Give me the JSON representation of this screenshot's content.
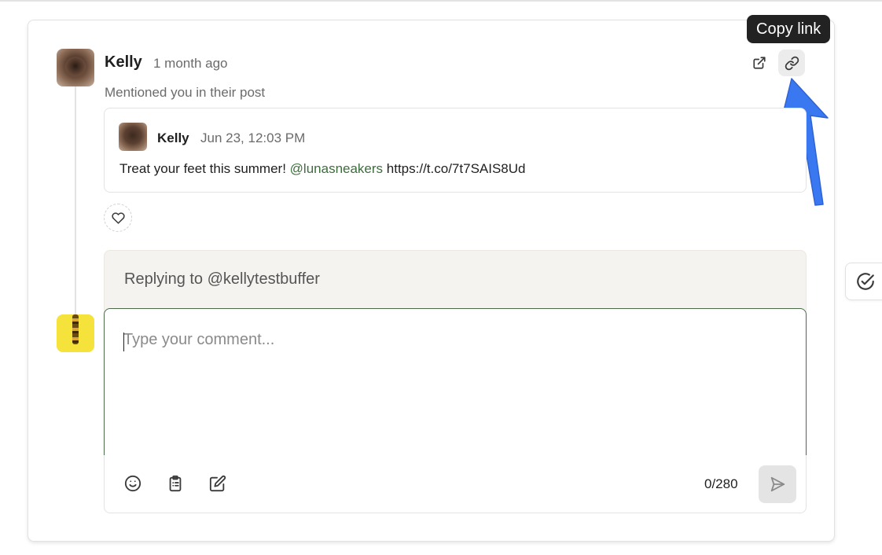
{
  "notification": {
    "author": "Kelly",
    "time": "1 month ago",
    "subtitle": "Mentioned you in their post",
    "tooltip": "Copy link"
  },
  "post": {
    "author": "Kelly",
    "date": "Jun 23, 12:03 PM",
    "text_before": "Treat your feet this summer! ",
    "mention": "@lunasneakers",
    "text_after": " https://t.co/7t7SAIS8Ud"
  },
  "reply": {
    "replying_to": "Replying to @kellytestbuffer",
    "placeholder": "Type your comment...",
    "value": "",
    "counter": "0/280"
  },
  "icons": {
    "open": "external-link-icon",
    "link": "link-icon",
    "like": "heart-icon",
    "emoji": "emoji-icon",
    "clipboard": "clipboard-list-icon",
    "edit": "edit-icon",
    "send": "send-icon",
    "check": "check-circle-icon"
  },
  "colors": {
    "mention": "#3c6e3c",
    "tooltip_bg": "#222222",
    "arrow": "#3a78f2",
    "input_border": "#4a6b4a"
  }
}
